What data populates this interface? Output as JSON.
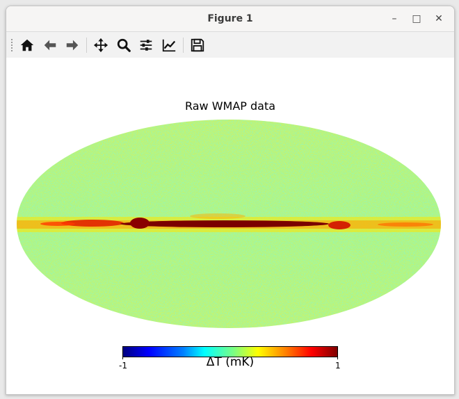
{
  "window": {
    "title": "Figure 1",
    "minimize_label": "–",
    "maximize_label": "□",
    "close_label": "✕"
  },
  "toolbar": {
    "buttons": [
      {
        "name": "home-icon",
        "tooltip": "Home"
      },
      {
        "name": "back-icon",
        "tooltip": "Back"
      },
      {
        "name": "forward-icon",
        "tooltip": "Forward"
      },
      {
        "name": "pan-icon",
        "tooltip": "Pan"
      },
      {
        "name": "zoom-icon",
        "tooltip": "Zoom"
      },
      {
        "name": "subplots-icon",
        "tooltip": "Subplots"
      },
      {
        "name": "customize-icon",
        "tooltip": "Customize"
      },
      {
        "name": "save-icon",
        "tooltip": "Save"
      }
    ]
  },
  "figure": {
    "title": "Raw WMAP data",
    "colorbar": {
      "label": "ΔT (mK)",
      "min_label": "-1",
      "max_label": "1",
      "colormap": "jet"
    }
  }
}
